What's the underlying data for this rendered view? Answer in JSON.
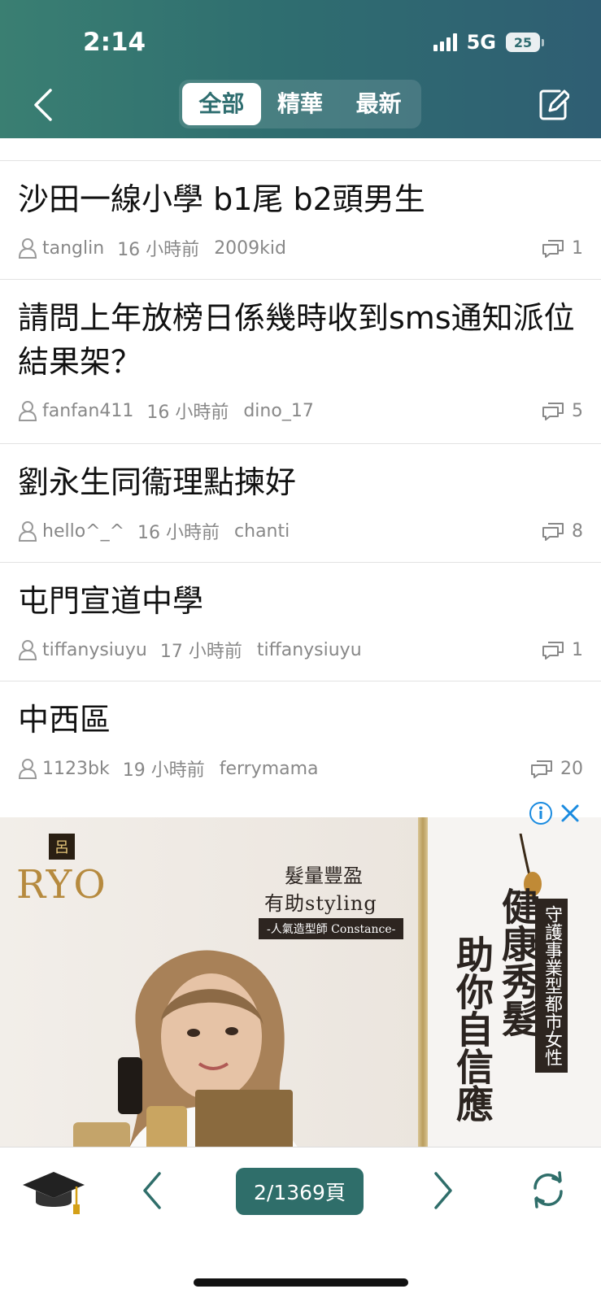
{
  "status": {
    "time": "2:14",
    "network": "5G",
    "battery": "25"
  },
  "header": {
    "tabs": [
      "全部",
      "精華",
      "最新"
    ],
    "active_tab": 0
  },
  "posts": [
    {
      "title": "沙田一線小學 b1尾 b2頭男生",
      "author": "tanglin",
      "time": "16 小時前",
      "last_reply": "2009kid",
      "replies": "1"
    },
    {
      "title": "請問上年放榜日係幾時收到sms通知派位結果架？",
      "author": "fanfan411",
      "time": "16 小時前",
      "last_reply": "dino_17",
      "replies": "5"
    },
    {
      "title": "劉永生同衞理點揀好",
      "author": "hello^_^",
      "time": "16 小時前",
      "last_reply": "chanti",
      "replies": "8"
    },
    {
      "title": "屯門宣道中學",
      "author": "tiffanysiuyu",
      "time": "17 小時前",
      "last_reply": "tiffanysiuyu",
      "replies": "1"
    },
    {
      "title": "中西區",
      "author": "1123bk",
      "time": "19 小時前",
      "last_reply": "ferrymama",
      "replies": "20"
    }
  ],
  "ad": {
    "brand_chip": "呂",
    "brand": "RYO",
    "headline1": "髮量豐盈",
    "headline2": "有助styling",
    "tagline": "-人氣造型師 Constance-",
    "vertical1": "健康秀髮",
    "vertical2": "助你自信應",
    "vertical3": "守護事業型都市女性"
  },
  "pager": {
    "label": "2/1369頁"
  },
  "colors": {
    "header_start": "#3a7f72",
    "header_end": "#2f5e73",
    "accent": "#2f6e6a"
  }
}
